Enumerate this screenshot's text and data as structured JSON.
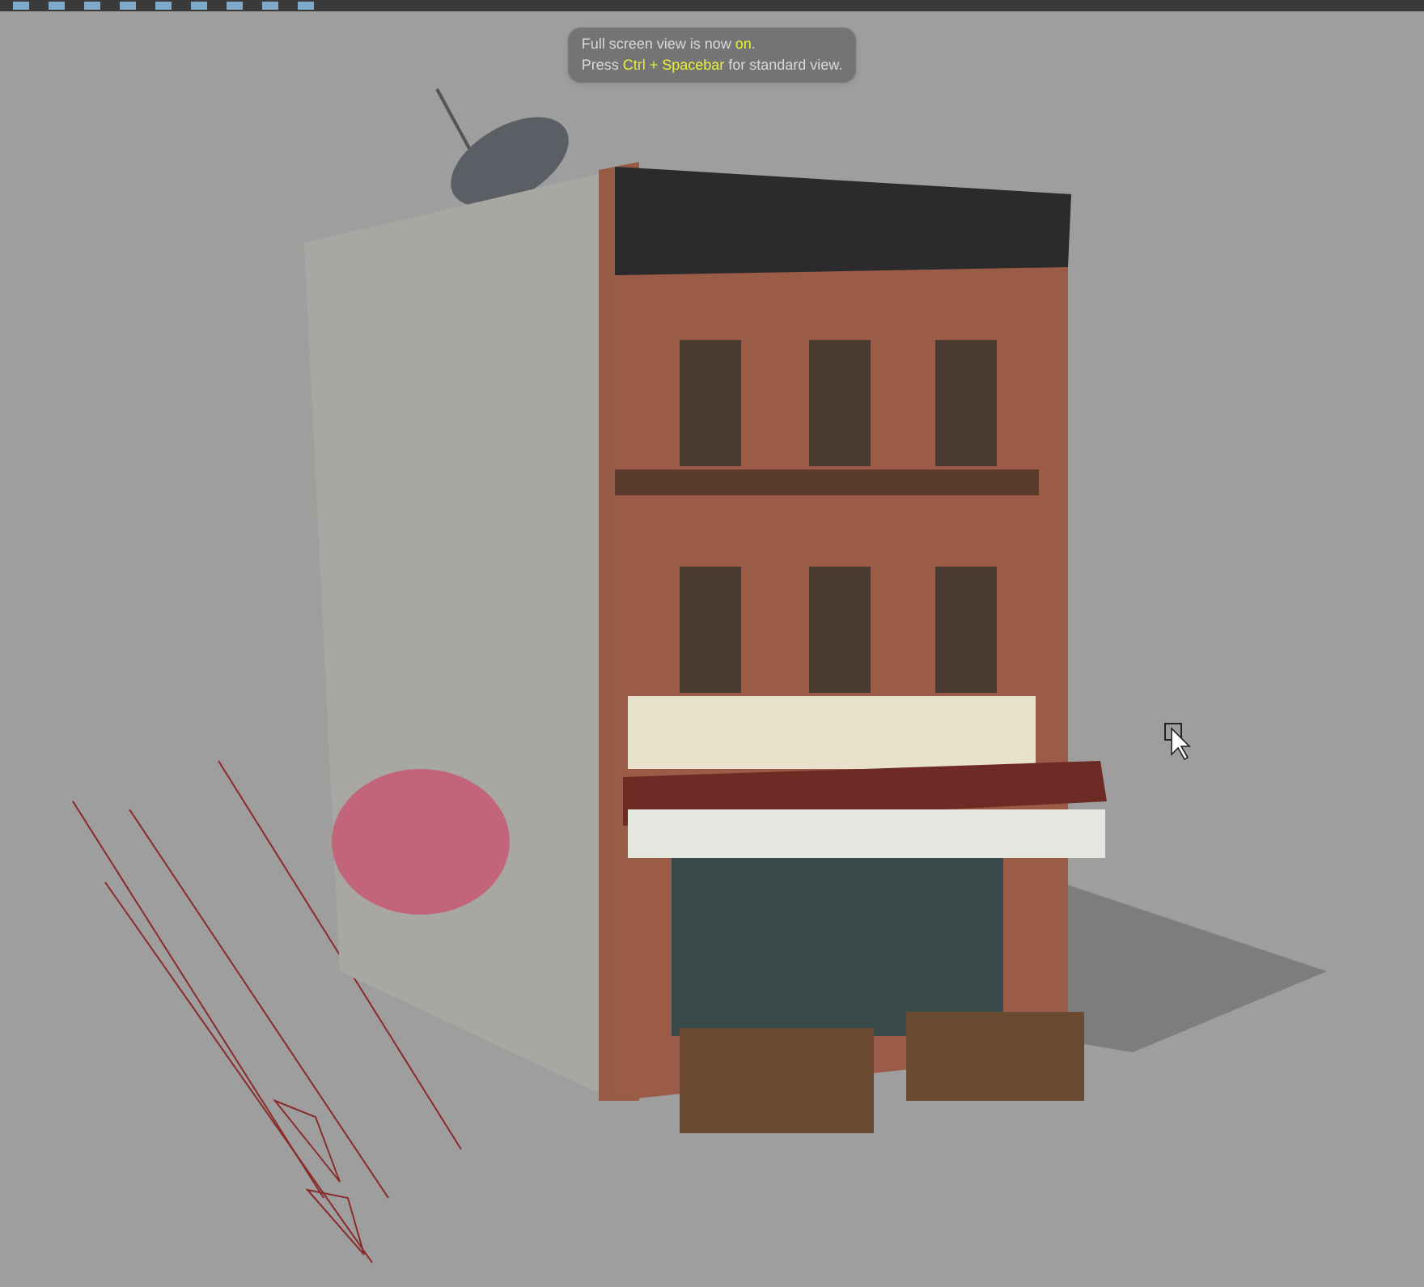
{
  "notification": {
    "lines": [
      {
        "segments": [
          {
            "text": "Full screen view is now ",
            "highlight": false
          },
          {
            "text": "on",
            "highlight": true
          },
          {
            "text": ".",
            "highlight": false
          }
        ]
      },
      {
        "segments": [
          {
            "text": "Press ",
            "highlight": false
          },
          {
            "text": "Ctrl + Spacebar",
            "highlight": true
          },
          {
            "text": " for standard view.",
            "highlight": false
          }
        ]
      }
    ]
  }
}
